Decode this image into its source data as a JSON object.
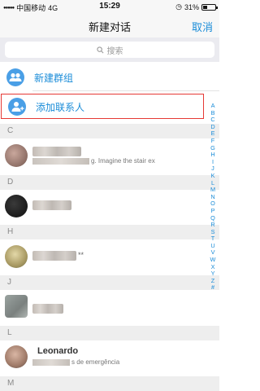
{
  "status_bar": {
    "carrier": "中国移动",
    "network": "4G",
    "time": "15:29",
    "battery": "31%"
  },
  "nav": {
    "title": "新建对话",
    "cancel": "取消"
  },
  "search": {
    "placeholder": "搜索"
  },
  "actions": [
    {
      "label": "新建群组",
      "icon": "group-icon"
    },
    {
      "label": "添加联系人",
      "icon": "add-person-icon"
    }
  ],
  "sections": [
    {
      "letter": "C",
      "contacts": [
        {
          "subtitle": "g. Imagine the stair ex"
        }
      ]
    },
    {
      "letter": "D",
      "contacts": [
        {
          "subtitle": ""
        }
      ]
    },
    {
      "letter": "H",
      "contacts": [
        {
          "subtitle": "**"
        }
      ]
    },
    {
      "letter": "J",
      "contacts": [
        {
          "subtitle": ""
        }
      ]
    },
    {
      "letter": "L",
      "contacts": [
        {
          "name": "Leonardo",
          "subtitle": "s de emergência"
        }
      ]
    },
    {
      "letter": "M",
      "contacts": []
    }
  ],
  "index_letters": [
    "A",
    "B",
    "C",
    "D",
    "E",
    "F",
    "G",
    "H",
    "I",
    "J",
    "K",
    "L",
    "M",
    "N",
    "O",
    "P",
    "Q",
    "R",
    "S",
    "T",
    "U",
    "V",
    "W",
    "X",
    "Y",
    "Z",
    "#"
  ],
  "colors": {
    "accent": "#1a8cd8",
    "highlight_border": "#e53935"
  }
}
